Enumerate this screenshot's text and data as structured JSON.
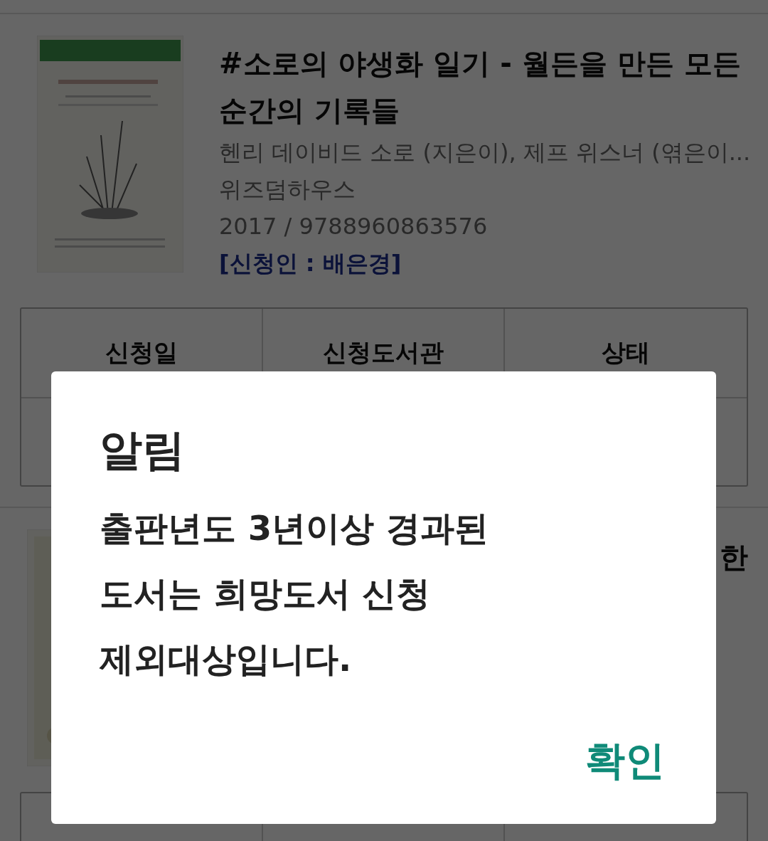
{
  "books": [
    {
      "title": "#소로의 야생화 일기 - 월든을 만든 모든 순간의 기록들",
      "author": "헨리 데이비드 소로 (지은이), 제프 위스너 (엮은이...",
      "publisher": "위즈덤하우스",
      "year_isbn": "2017 / 9788960863576",
      "applicant": "[신청인 : 배은경]",
      "table": {
        "columns": [
          "신청일",
          "신청도서관",
          "상태"
        ]
      }
    },
    {
      "title": "한"
    }
  ],
  "dialog": {
    "title": "알림",
    "message": "출판년도 3년이상 경과된\n도서는 희망도서 신청\n제외대상입니다.",
    "button": "확인"
  }
}
